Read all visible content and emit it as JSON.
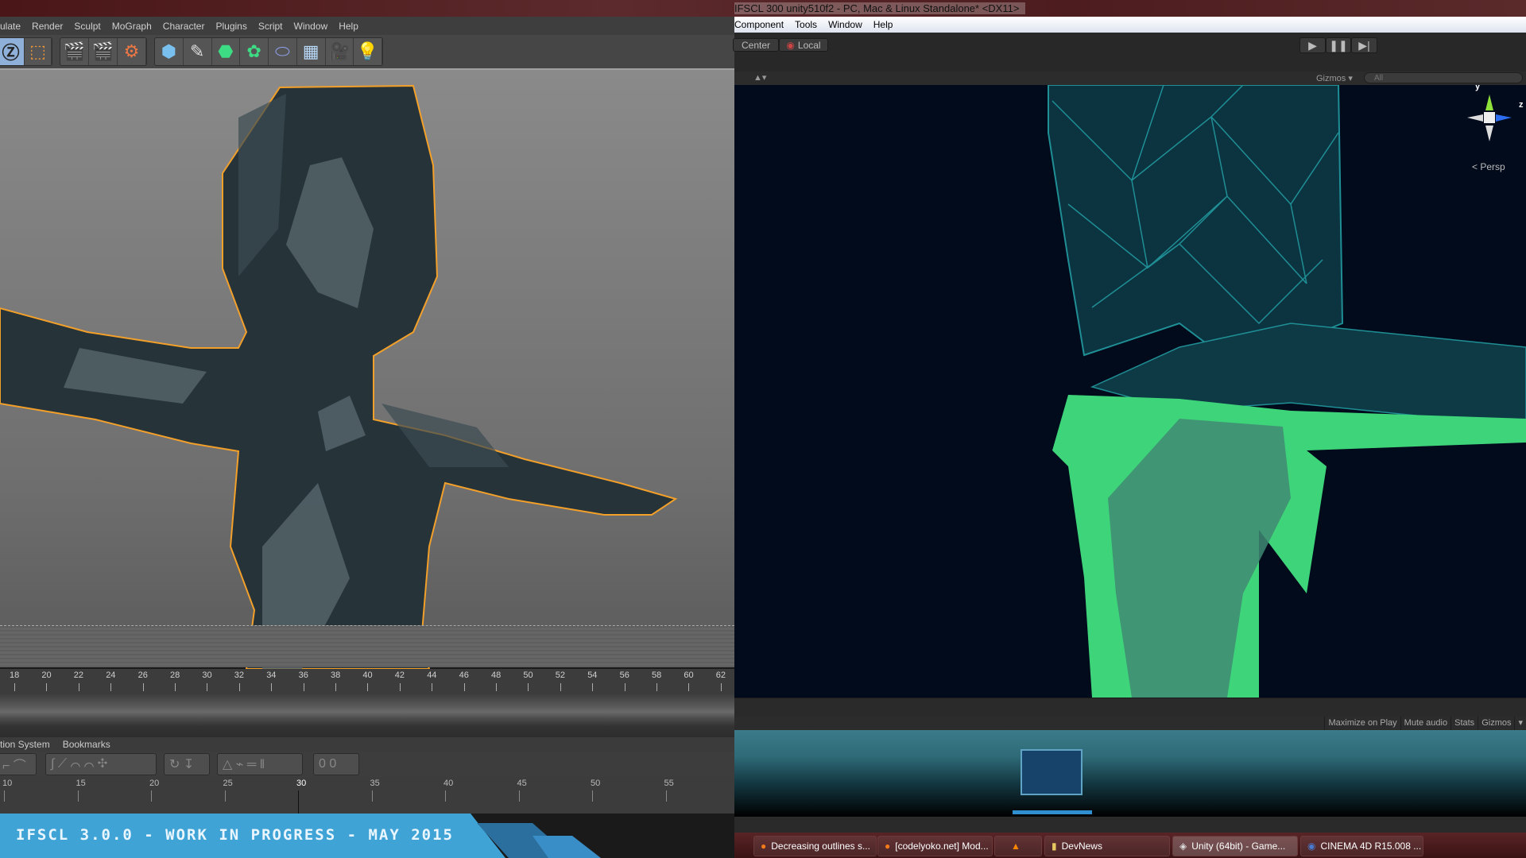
{
  "unity": {
    "title": "IFSCL 300 unity510f2 - PC, Mac & Linux Standalone* <DX11>",
    "menu": [
      "Component",
      "Tools",
      "Window",
      "Help"
    ],
    "pivot": "Center",
    "space": "Local",
    "scene": {
      "gizmos": "Gizmos",
      "search_placeholder": "All",
      "persp": "Persp",
      "axis_y": "y",
      "axis_z": "z"
    },
    "game": {
      "buttons": [
        "Maximize on Play",
        "Mute audio",
        "Stats",
        "Gizmos"
      ]
    }
  },
  "c4d": {
    "menu": [
      "ulate",
      "Render",
      "Sculpt",
      "MoGraph",
      "Character",
      "Plugins",
      "Script",
      "Window",
      "Help"
    ],
    "timeline_ticks": [
      18,
      20,
      22,
      24,
      26,
      28,
      30,
      32,
      34,
      36,
      38,
      40,
      42,
      44,
      46,
      48,
      50,
      52,
      54,
      56,
      58,
      60,
      62
    ],
    "tabs": [
      "tion System",
      "Bookmarks"
    ],
    "fcurve_ticks": [
      10,
      15,
      20,
      25,
      30,
      35,
      40,
      45,
      50,
      55
    ],
    "current_frame": 30
  },
  "banner": {
    "text": "IFSCL 3.0.0 - WORK IN PROGRESS - MAY 2015",
    "color": "#3fa3d6"
  },
  "taskbar": [
    {
      "label": "Decreasing outlines s...",
      "icon": "firefox-icon"
    },
    {
      "label": "[codelyoko.net] Mod...",
      "icon": "firefox-icon"
    },
    {
      "label": "",
      "icon": "vlc-icon"
    },
    {
      "label": "DevNews",
      "icon": "folder-icon"
    },
    {
      "label": "Unity (64bit) - Game...",
      "icon": "unity-icon",
      "active": true
    },
    {
      "label": "CINEMA 4D R15.008 ...",
      "icon": "cinema4d-icon"
    }
  ]
}
